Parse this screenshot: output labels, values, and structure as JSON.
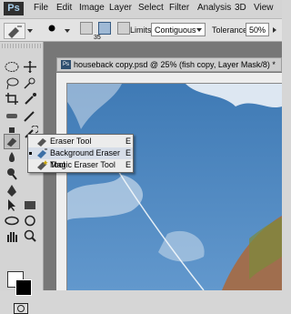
{
  "app": {
    "logo": "Ps"
  },
  "menu": [
    "File",
    "Edit",
    "Image",
    "Layer",
    "Select",
    "Filter",
    "Analysis",
    "3D",
    "View"
  ],
  "options": {
    "brush_size": "35",
    "limits_label": "Limits:",
    "limits_value": "Contiguous",
    "tolerance_label": "Tolerance:",
    "tolerance_value": "50%"
  },
  "document": {
    "tab_title": "houseback copy.psd @ 25% (fish copy, Layer Mask/8) *"
  },
  "flyout": [
    {
      "label": "Eraser Tool",
      "key": "E",
      "selected": false,
      "icon": "eraser-icon"
    },
    {
      "label": "Background Eraser Tool",
      "key": "E",
      "selected": true,
      "icon": "background-eraser-icon"
    },
    {
      "label": "Magic Eraser Tool",
      "key": "E",
      "selected": false,
      "icon": "magic-eraser-icon"
    }
  ],
  "colors": {
    "foreground": "#ffffff",
    "background": "#000000",
    "sky": "#4f86bd",
    "hill": "#a06e4e"
  }
}
